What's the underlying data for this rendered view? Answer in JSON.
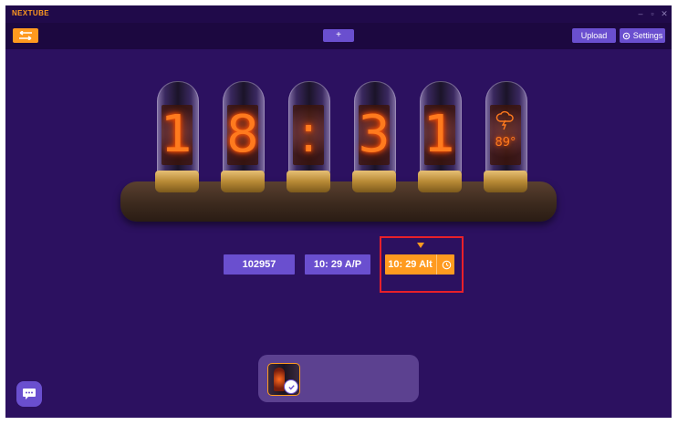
{
  "window": {
    "title": "NEXTUBE",
    "controls": [
      "minimize-icon",
      "restore-icon",
      "close-icon"
    ]
  },
  "toolbar": {
    "back_icon": "swap-arrows-icon",
    "add_label": "+",
    "upload_label": "Upload",
    "settings_label": "Settings",
    "settings_icon": "gear-icon"
  },
  "clock": {
    "digits": [
      "1",
      "8",
      ":",
      "3",
      "1"
    ],
    "weather": {
      "icon": "thunderstorm-cloud-icon",
      "temp": "89°"
    }
  },
  "modes": {
    "countdown": "102957",
    "ampm": "10: 29 A/P",
    "alt": "10: 29 Alt",
    "alt_icon": "clock-settings-icon",
    "selected": "alt"
  },
  "theme_panel": {
    "selected_icon": "check-icon"
  },
  "chat": {
    "icon": "chat-bubble-icon"
  },
  "colors": {
    "background": "#2c1160",
    "titlebar": "#200a4a",
    "toolbar": "#1c0840",
    "accent_orange": "#ff9a1f",
    "button_purple": "#6a4fcf",
    "highlight_red": "#e8202a",
    "tube_glow": "#ff7a1e"
  }
}
